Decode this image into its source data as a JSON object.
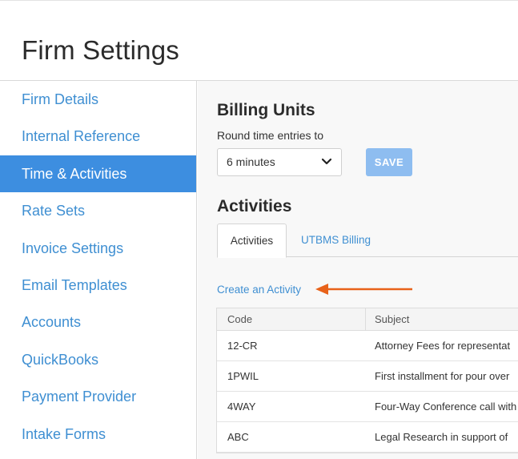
{
  "page": {
    "title": "Firm Settings"
  },
  "sidebar": {
    "items": [
      {
        "label": "Firm Details"
      },
      {
        "label": "Internal Reference"
      },
      {
        "label": "Time & Activities",
        "active": true
      },
      {
        "label": "Rate Sets"
      },
      {
        "label": "Invoice Settings"
      },
      {
        "label": "Email Templates"
      },
      {
        "label": "Accounts"
      },
      {
        "label": "QuickBooks"
      },
      {
        "label": "Payment Provider"
      },
      {
        "label": "Intake Forms"
      }
    ]
  },
  "billing": {
    "title": "Billing Units",
    "round_label": "Round time entries to",
    "selected_value": "6 minutes",
    "save_label": "SAVE"
  },
  "activities": {
    "title": "Activities",
    "tabs": [
      {
        "label": "Activities",
        "active": true
      },
      {
        "label": "UTBMS Billing",
        "active": false
      }
    ],
    "create_link": "Create an Activity",
    "table": {
      "columns": [
        "Code",
        "Subject"
      ],
      "rows": [
        {
          "code": "12-CR",
          "subject": "Attorney Fees for representat"
        },
        {
          "code": "1PWIL",
          "subject": "First installment for pour over"
        },
        {
          "code": "4WAY",
          "subject": "Four-Way Conference call with"
        },
        {
          "code": "ABC",
          "subject": "Legal Research in support of"
        }
      ]
    }
  },
  "colors": {
    "accent": "#3d8ee0",
    "link": "#3f8fd2",
    "save_button": "#8ebdf0",
    "annotation_arrow": "#e8621a"
  }
}
